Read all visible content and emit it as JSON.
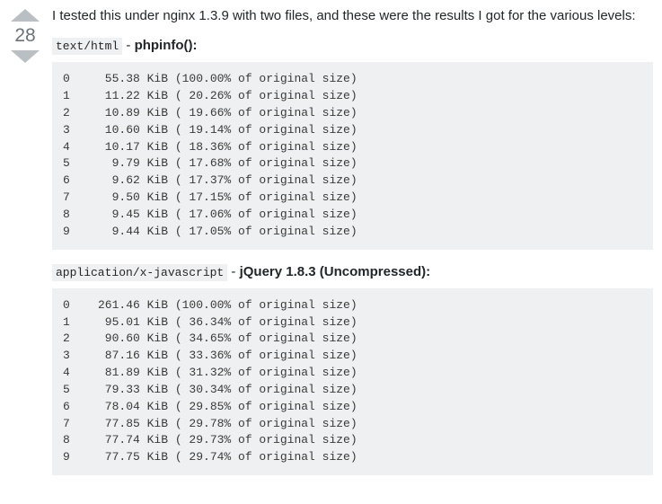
{
  "vote": {
    "score": "28"
  },
  "intro": "I tested this under nginx 1.3.9 with two files, and these were the results I got for the various levels:",
  "sections": [
    {
      "mime": "text/html",
      "desc": "phpinfo():",
      "rows": [
        {
          "level": "0",
          "size": "55.38",
          "pct": "100.00"
        },
        {
          "level": "1",
          "size": "11.22",
          "pct": "20.26"
        },
        {
          "level": "2",
          "size": "10.89",
          "pct": "19.66"
        },
        {
          "level": "3",
          "size": "10.60",
          "pct": "19.14"
        },
        {
          "level": "4",
          "size": "10.17",
          "pct": "18.36"
        },
        {
          "level": "5",
          "size": "9.79",
          "pct": "17.68"
        },
        {
          "level": "6",
          "size": "9.62",
          "pct": "17.37"
        },
        {
          "level": "7",
          "size": "9.50",
          "pct": "17.15"
        },
        {
          "level": "8",
          "size": "9.45",
          "pct": "17.06"
        },
        {
          "level": "9",
          "size": "9.44",
          "pct": "17.05"
        }
      ]
    },
    {
      "mime": "application/x-javascript",
      "desc": "jQuery 1.8.3 (Uncompressed):",
      "rows": [
        {
          "level": "0",
          "size": "261.46",
          "pct": "100.00"
        },
        {
          "level": "1",
          "size": "95.01",
          "pct": "36.34"
        },
        {
          "level": "2",
          "size": "90.60",
          "pct": "34.65"
        },
        {
          "level": "3",
          "size": "87.16",
          "pct": "33.36"
        },
        {
          "level": "4",
          "size": "81.89",
          "pct": "31.32"
        },
        {
          "level": "5",
          "size": "79.33",
          "pct": "30.34"
        },
        {
          "level": "6",
          "size": "78.04",
          "pct": "29.85"
        },
        {
          "level": "7",
          "size": "77.85",
          "pct": "29.78"
        },
        {
          "level": "8",
          "size": "77.74",
          "pct": "29.73"
        },
        {
          "level": "9",
          "size": "77.75",
          "pct": "29.74"
        }
      ]
    }
  ]
}
